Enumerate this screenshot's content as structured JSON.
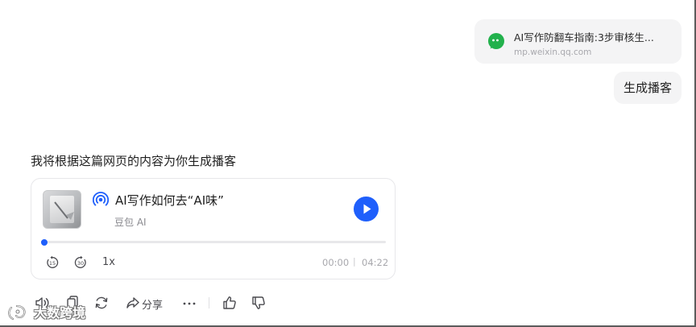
{
  "link_card": {
    "title": "AI写作防翻车指南:3步审核生...",
    "url": "mp.weixin.qq.com",
    "icon": "wechat-icon"
  },
  "user_message": "生成播客",
  "reply_text": "我将根据这篇网页的内容为你生成播客",
  "podcast": {
    "title": "AI写作如何去“AI味”",
    "subtitle": "豆包 AI",
    "speed": "1x",
    "current_time": "00:00",
    "separator": "|",
    "duration": "04:22",
    "progress": 0.01,
    "rewind_seconds": "15",
    "forward_seconds": "30"
  },
  "actions": {
    "share_label": "分享",
    "items": [
      "speaker-icon",
      "copy-icon",
      "refresh-icon",
      "share-icon",
      "more-icon",
      "thumbs-up-icon",
      "thumbs-down-icon"
    ]
  },
  "watermark": {
    "text": "大数跨境"
  },
  "colors": {
    "accent": "#1f5ffb",
    "wechat": "#22b14c",
    "bubble": "#f4f4f5"
  }
}
